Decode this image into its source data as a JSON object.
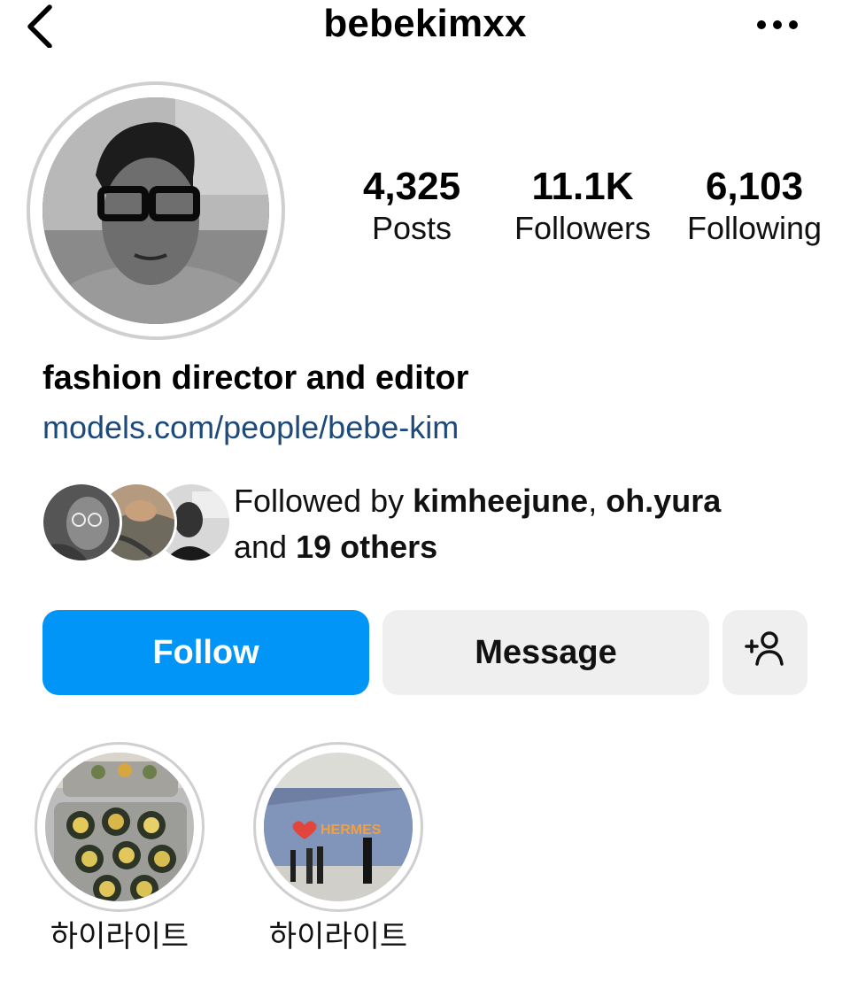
{
  "header": {
    "username": "bebekimxx",
    "back_icon": "chevron-left-icon",
    "more_icon": "more-horizontal-icon"
  },
  "profile": {
    "stats": {
      "posts": {
        "value": "4,325",
        "label": "Posts"
      },
      "followers": {
        "value": "11.1K",
        "label": "Followers"
      },
      "following": {
        "value": "6,103",
        "label": "Following"
      }
    },
    "bio": "fashion director and editor",
    "link": "models.com/people/bebe-kim"
  },
  "mutual": {
    "prefix": "Followed by ",
    "user1": "kimheejune",
    "separator": ", ",
    "user2": "oh.yura",
    "and": "and ",
    "others": "19 others"
  },
  "actions": {
    "follow_label": "Follow",
    "message_label": "Message",
    "suggest_icon": "add-person-icon"
  },
  "highlights": [
    {
      "label": "하이라이트"
    },
    {
      "label": "하이라이트"
    }
  ],
  "colors": {
    "follow_button": "#0095f6",
    "secondary_button": "#efefef",
    "link": "#1c4a7c",
    "ring": "#cfcfcf"
  }
}
